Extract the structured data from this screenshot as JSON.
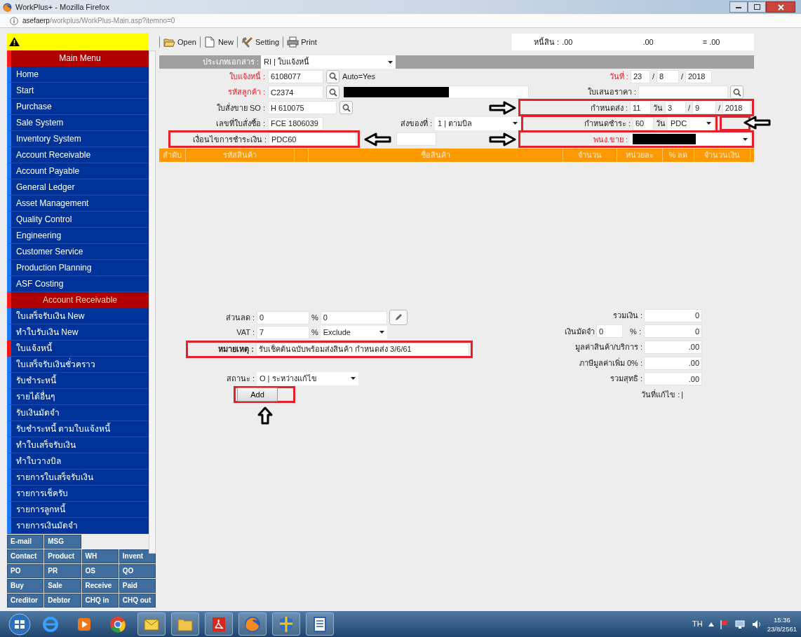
{
  "window": {
    "title": "WorkPlus+ - Mozilla Firefox"
  },
  "address_bar": {
    "host": "asefaerp",
    "path": "/workplus/WorkPlus-Main.asp?itemno=0"
  },
  "sidebar": {
    "sections": [
      {
        "title": "Main Menu",
        "items": [
          {
            "label": "Home",
            "selected": false
          },
          {
            "label": "Start",
            "selected": false
          },
          {
            "label": "Purchase",
            "selected": false
          },
          {
            "label": "Sale System",
            "selected": false
          },
          {
            "label": "Inventory System",
            "selected": false
          },
          {
            "label": "Account Receivable",
            "selected": false
          },
          {
            "label": "Account Payable",
            "selected": false
          },
          {
            "label": "General Ledger",
            "selected": false
          },
          {
            "label": "Asset Management",
            "selected": false
          },
          {
            "label": "Quality Control",
            "selected": false
          },
          {
            "label": "Engineering",
            "selected": false
          },
          {
            "label": "Customer Service",
            "selected": false
          },
          {
            "label": "Production Planning",
            "selected": false
          },
          {
            "label": "ASF Costing",
            "selected": false
          }
        ]
      },
      {
        "title": "Account Receivable",
        "items": [
          {
            "label": "ใบเสร็จรับเงิน New",
            "selected": false
          },
          {
            "label": "ทำใบรับเงิน New",
            "selected": false
          },
          {
            "label": "ใบแจ้งหนี้",
            "selected": true
          },
          {
            "label": "ใบเสร็จรับเงินชั่วคราว",
            "selected": false
          },
          {
            "label": "รับชำระหนี้",
            "selected": false
          },
          {
            "label": "รายได้อื่นๆ",
            "selected": false
          },
          {
            "label": "รับเงินมัดจำ",
            "selected": false
          },
          {
            "label": "รับชำระหนี้ ตามใบแจ้งหนี้",
            "selected": false
          },
          {
            "label": "ทำใบเสร็จรับเงิน",
            "selected": false
          },
          {
            "label": "ทำใบวางบิล",
            "selected": false
          },
          {
            "label": "รายการใบเสร็จรับเงิน",
            "selected": false
          },
          {
            "label": "รายการเช็ครับ",
            "selected": false
          },
          {
            "label": "รายการลูกหนี้",
            "selected": false
          },
          {
            "label": "รายการเงินมัดจำ",
            "selected": false
          }
        ]
      }
    ],
    "shortcut_rows": [
      [
        "E-mail",
        "MSG"
      ],
      [
        "Contact",
        "Product",
        "WH",
        "Invent"
      ],
      [
        "PO",
        "PR",
        "OS",
        "QO"
      ],
      [
        "Buy",
        "Sale",
        "Receive",
        "Paid"
      ],
      [
        "Creditor",
        "Debtor",
        "CHQ in",
        "CHQ out"
      ]
    ]
  },
  "toolbar": {
    "buttons": [
      {
        "kind": "open",
        "label": "Open"
      },
      {
        "kind": "new",
        "label": "New"
      },
      {
        "kind": "setting",
        "label": "Setting"
      },
      {
        "kind": "print",
        "label": "Print"
      }
    ],
    "balance": {
      "label": "หนี้สิน :",
      "value": ".00",
      "value_2": ".00",
      "total": "= .00"
    }
  },
  "document_type": {
    "label": "ประเภทเอกสาร :",
    "value": "RI | ใบแจ้งหนี้"
  },
  "header": {
    "invoice_no": {
      "label": "ใบแจ้งหนี้ :",
      "required": true,
      "value": "6108077",
      "note": "Auto=Yes"
    },
    "customer_code": {
      "label": "รหัสลูกค้า :",
      "required": true,
      "value": "C2374",
      "redacted": true
    },
    "sales_order": {
      "label": "ใบสั่งขาย SO :",
      "required": false,
      "value": "H 610075"
    },
    "po_number": {
      "label": "เลขที่ใบสั่งซื้อ :",
      "required": false,
      "value": "FCE 1806039"
    },
    "ship_to": {
      "label": "ส่งของที่ :",
      "required": false,
      "value": "1 | ตามบิล"
    },
    "payment_terms": {
      "label": "เงื่อนไขการชำระเงิน :",
      "required": false,
      "value": "PDC60",
      "highlighted": true,
      "arrow": {
        "kind": "left"
      }
    },
    "date": {
      "label": "วันที่ :",
      "required": true,
      "day": "23",
      "month": "8",
      "year": "2018",
      "separators": [
        "/",
        "/"
      ]
    },
    "quotation": {
      "label": "ใบเสนอราคา :",
      "required": false
    },
    "delivery": {
      "label": "กำหนดส่ง :",
      "required": false,
      "days": "11",
      "unit": "วัน",
      "day": "3",
      "month": "9",
      "year": "2018",
      "separators": [
        "/",
        "/"
      ],
      "highlighted": true,
      "arrow": {
        "kind": "right"
      }
    },
    "payment_due": {
      "label": "กำหนดชำระ :",
      "required": false,
      "days": "60",
      "unit": "วัน",
      "value": "PDC",
      "highlighted": true,
      "empty_highlight": true,
      "arrow": {
        "kind": "left"
      }
    },
    "salesperson": {
      "label": "พนง.ขาย :",
      "required": true,
      "redacted": true,
      "highlighted": true,
      "arrow": {
        "kind": "right"
      }
    }
  },
  "items_table": {
    "columns": [
      {
        "kind": "text",
        "label": "ลำดับ"
      },
      {
        "kind": "text",
        "label": "รหัสสินค้า"
      },
      {
        "kind": "blank"
      },
      {
        "kind": "text",
        "label": "ชื่อสินค้า"
      },
      {
        "kind": "text",
        "label": "จำนวน"
      },
      {
        "kind": "text",
        "label": "หน่วยละ"
      },
      {
        "kind": "text",
        "label": "% ลด"
      },
      {
        "kind": "text",
        "label": "จำนวนเงิน"
      }
    ]
  },
  "footer": {
    "discount": {
      "label": "ส่วนลด :",
      "value": "0",
      "percent_sign": "%",
      "percent": "0"
    },
    "vat": {
      "label": "VAT :",
      "value": "7",
      "percent_sign": "%",
      "mode": "Exclude"
    },
    "remark": {
      "label": "หมายเหตุ :",
      "value": "รับเช็คต้นฉบับพร้อมส่งสินค้า กำหนดส่ง 3/6/61",
      "highlighted": true
    },
    "status": {
      "label": "สถานะ :",
      "value": "O | ระหว่างแก้ไข"
    },
    "add_button": {
      "label": "Add",
      "highlighted": true,
      "arrow": {
        "kind": "up"
      }
    },
    "totals": [
      {
        "label": "รวมเงิน :",
        "value": "0"
      },
      {
        "label": "เงินมัดจำ",
        "input": "0",
        "suffix": "% :",
        "value": "0"
      },
      {
        "label": "มูลค่าสินค้า/บริการ :",
        "value": ".00"
      },
      {
        "label": "ภาษีมูลค่าเพิ่ม 0% :",
        "value": ".00"
      },
      {
        "label": "รวมสุทธิ :",
        "value": ".00"
      }
    ],
    "edited_date": {
      "label": "วันที่แก้ไข :",
      "value": "|"
    }
  },
  "taskbar": {
    "apps": [
      {
        "kind": "ie",
        "running": false
      },
      {
        "kind": "media",
        "running": false
      },
      {
        "kind": "chrome",
        "running": false
      },
      {
        "kind": "mail",
        "running": true
      },
      {
        "kind": "folder",
        "running": true
      },
      {
        "kind": "pdf",
        "running": true
      },
      {
        "kind": "firefox",
        "running": true
      },
      {
        "kind": "shield",
        "running": true
      },
      {
        "kind": "word",
        "running": true
      }
    ],
    "tray": {
      "language": "TH",
      "time": "15:36",
      "date": "23/8/2561"
    }
  }
}
